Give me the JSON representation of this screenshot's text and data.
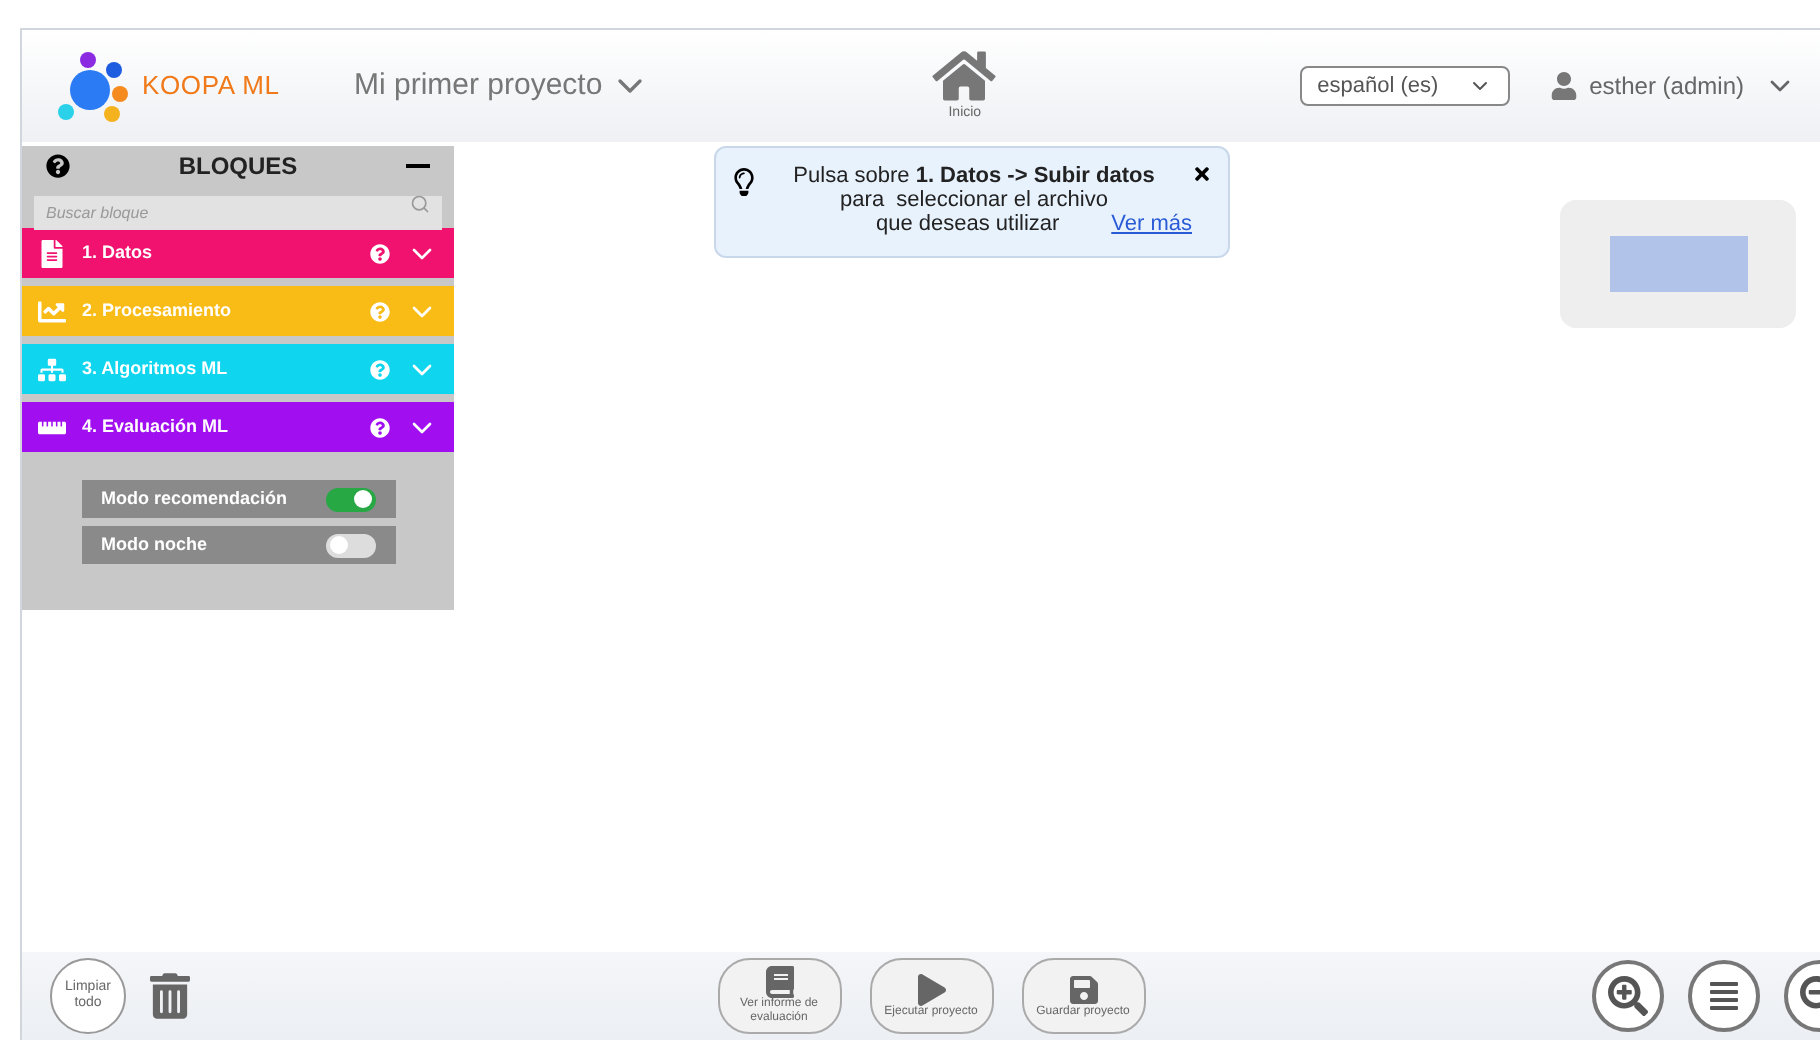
{
  "header": {
    "logo": "KOOPA ML",
    "project": "Mi primer proyecto",
    "home_label": "Inicio",
    "language": "español (es)",
    "user": "esther (admin)"
  },
  "sidebar": {
    "title": "BLOQUES",
    "search": {
      "placeholder": "Buscar bloque"
    },
    "blocks": [
      {
        "label": "1. Datos",
        "color": "#f0126e",
        "kind": "file"
      },
      {
        "label": "2. Procesamiento",
        "color": "#f9bb15",
        "kind": "chart"
      },
      {
        "label": "3. Algoritmos ML",
        "color": "#0fd5ef",
        "kind": "tree"
      },
      {
        "label": "4. Evaluación ML",
        "color": "#a10ff0",
        "kind": "ruler"
      }
    ],
    "toggles": [
      {
        "label": "Modo recomendación",
        "on": true
      },
      {
        "label": "Modo noche",
        "on": false
      }
    ]
  },
  "hint": {
    "text": "Pulsa sobre **1. Datos -> Subir datos**",
    "line2": "para  seleccionar el archivo",
    "line3": "que deseas utilizar",
    "link": "Ver más"
  },
  "bottom": {
    "clear": "Limpiar todo",
    "actions": [
      {
        "label": "Ver informe de evaluación",
        "kind": "report"
      },
      {
        "label": "Ejecutar proyecto",
        "kind": "run"
      },
      {
        "label": "Guardar proyecto",
        "kind": "save"
      }
    ]
  }
}
